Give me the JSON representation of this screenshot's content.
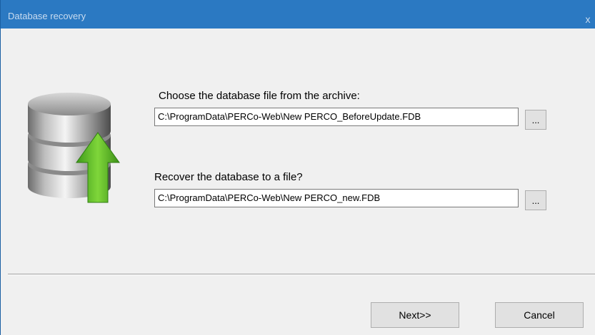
{
  "window": {
    "title": "Database recovery",
    "close_glyph": "x"
  },
  "icon": {
    "name": "database-restore-icon"
  },
  "source": {
    "label": "Choose the database file from the archive:",
    "value": "C:\\ProgramData\\PERCo-Web\\New PERCO_BeforeUpdate.FDB",
    "browse_label": "..."
  },
  "target": {
    "label": "Recover the database to a file?",
    "value": "C:\\ProgramData\\PERCo-Web\\New PERCO_new.FDB",
    "browse_label": "..."
  },
  "footer": {
    "next_label": "Next>>",
    "cancel_label": "Cancel"
  },
  "colors": {
    "titlebar": "#2b79c2",
    "arrow": "#5fc028",
    "window_bg": "#f0f0f0"
  }
}
